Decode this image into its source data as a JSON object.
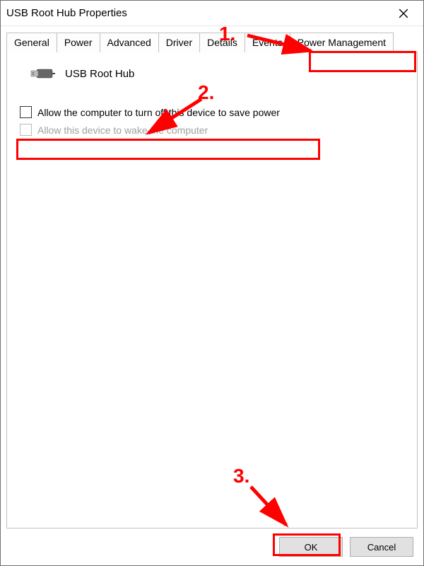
{
  "window": {
    "title": "USB Root Hub Properties"
  },
  "tabs": [
    {
      "label": "General"
    },
    {
      "label": "Power"
    },
    {
      "label": "Advanced"
    },
    {
      "label": "Driver"
    },
    {
      "label": "Details"
    },
    {
      "label": "Events"
    },
    {
      "label": "Power Management"
    }
  ],
  "device": {
    "name": "USB Root Hub"
  },
  "checkboxes": {
    "allow_off": "Allow the computer to turn off this device to save power",
    "wake": "Allow this device to wake the computer"
  },
  "buttons": {
    "ok": "OK",
    "cancel": "Cancel"
  },
  "annotations": {
    "one": "1.",
    "two": "2.",
    "three": "3."
  }
}
